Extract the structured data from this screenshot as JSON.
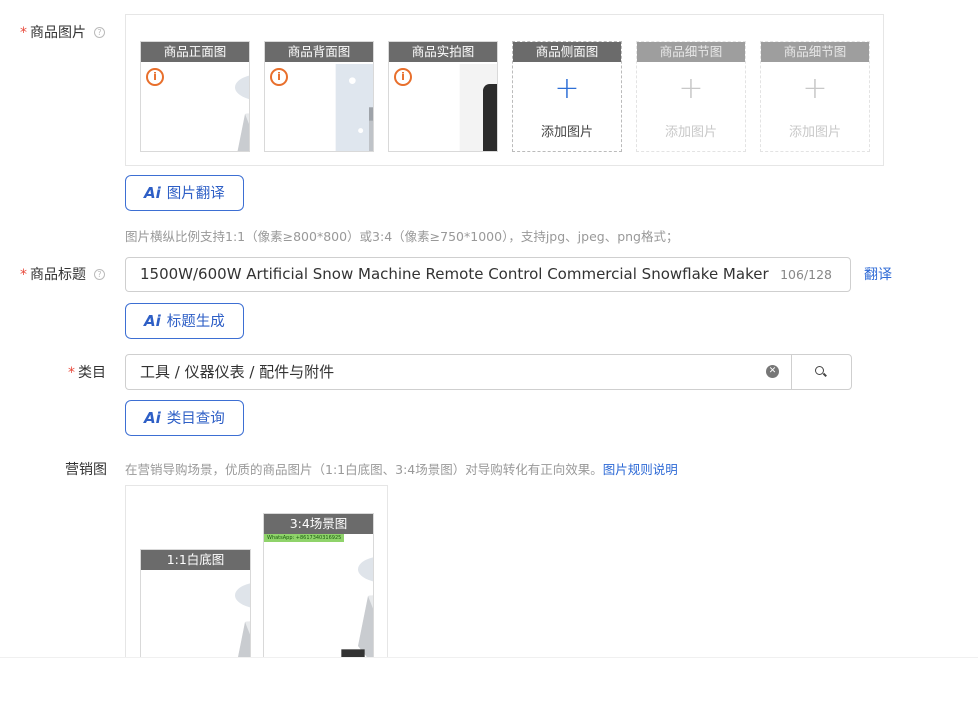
{
  "product_images": {
    "label": "商品图片",
    "required_mark": "*",
    "help_glyph": "?",
    "slots": [
      {
        "title": "商品正面图",
        "state": "filled",
        "warning": true
      },
      {
        "title": "商品背面图",
        "state": "filled",
        "warning": true
      },
      {
        "title": "商品实拍图",
        "state": "filled",
        "warning": true
      },
      {
        "title": "商品侧面图",
        "state": "empty",
        "add_text": "添加图片"
      },
      {
        "title": "商品细节图",
        "state": "disabled",
        "add_text": "添加图片"
      },
      {
        "title": "商品细节图",
        "state": "disabled",
        "add_text": "添加图片"
      }
    ],
    "ai_button": {
      "ai": "Ai",
      "label": "图片翻译"
    },
    "hint": "图片横纵比例支持1:1（像素≥800*800）或3:4（像素≥750*1000），支持jpg、jpeg、png格式；"
  },
  "product_title": {
    "label": "商品标题",
    "required_mark": "*",
    "help_glyph": "?",
    "value": "1500W/600W Artificial Snow Machine Remote Control Commercial Snowflake Maker Weddi",
    "count": "106/128",
    "translate_link": "翻译",
    "ai_button": {
      "ai": "Ai",
      "label": "标题生成"
    }
  },
  "category": {
    "label": "类目",
    "required_mark": "*",
    "value": "工具 / 仪器仪表 / 配件与附件",
    "clear_glyph": "✕",
    "ai_button": {
      "ai": "Ai",
      "label": "类目查询"
    }
  },
  "marketing": {
    "label": "营销图",
    "hint": "在营销导购场景，优质的商品图片（1:1白底图、3:4场景图）对导购转化有正向效果。",
    "rules_link": "图片规则说明",
    "slots": [
      {
        "title": "1:1白底图"
      },
      {
        "title": "3:4场景图",
        "watermark": "WhatsApp: +8617340316925"
      }
    ]
  },
  "colors": {
    "accent": "#2e6ad6",
    "required": "#e84a3c",
    "warning": "#e86f2c",
    "slot_header": "#6b6b6b"
  },
  "icons": [
    "help-icon",
    "warning-icon",
    "plus-icon",
    "clear-icon",
    "search-icon",
    "ai-icon"
  ]
}
